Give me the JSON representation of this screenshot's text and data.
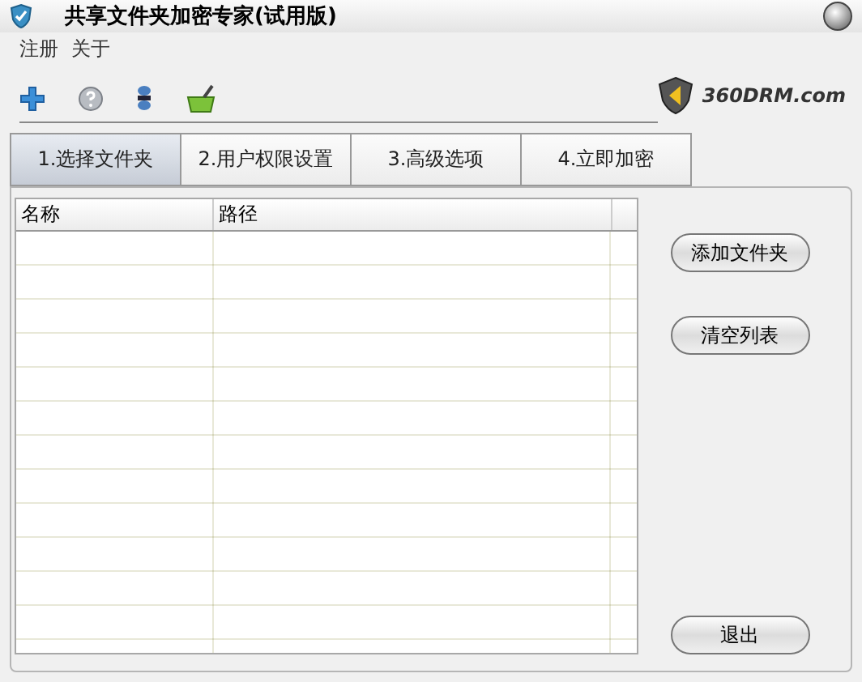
{
  "window": {
    "title": "共享文件夹加密专家(试用版)"
  },
  "menu": [
    "注册",
    "关于"
  ],
  "logo": {
    "text": "360DRM.com"
  },
  "tabs": [
    {
      "label": "1.选择文件夹",
      "selected": true
    },
    {
      "label": "2.用户权限设置",
      "selected": false
    },
    {
      "label": "3.高级选项",
      "selected": false
    },
    {
      "label": "4.立即加密",
      "selected": false
    }
  ],
  "table": {
    "columns": [
      "名称",
      "路径"
    ]
  },
  "buttons": [
    "添加文件夹",
    "清空列表"
  ],
  "exit_button": "退出"
}
